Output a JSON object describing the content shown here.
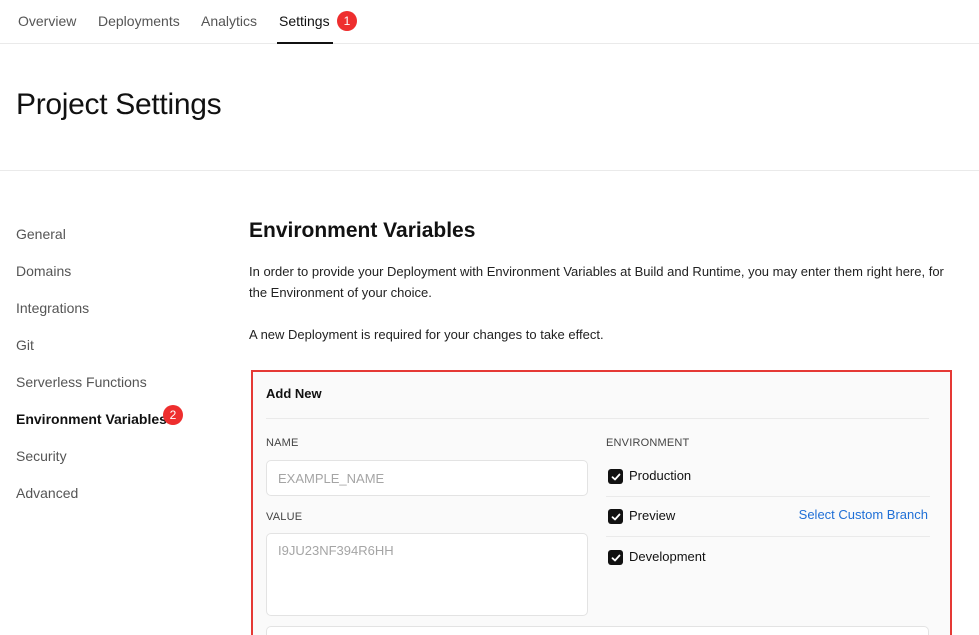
{
  "nav": {
    "tabs": [
      {
        "label": "Overview"
      },
      {
        "label": "Deployments"
      },
      {
        "label": "Analytics"
      },
      {
        "label": "Settings",
        "badge": "1"
      }
    ]
  },
  "header": {
    "title": "Project Settings"
  },
  "sidebar": {
    "items": [
      {
        "label": "General"
      },
      {
        "label": "Domains"
      },
      {
        "label": "Integrations"
      },
      {
        "label": "Git"
      },
      {
        "label": "Serverless Functions"
      },
      {
        "label": "Environment Variables",
        "badge": "2"
      },
      {
        "label": "Security"
      },
      {
        "label": "Advanced"
      }
    ]
  },
  "main": {
    "title": "Environment Variables",
    "description": "In order to provide your Deployment with Environment Variables at Build and Runtime, you may enter them right here, for the Environment of your choice.",
    "note": "A new Deployment is required for your changes to take effect."
  },
  "panel": {
    "title": "Add New",
    "name_label": "NAME",
    "name_placeholder": "EXAMPLE_NAME",
    "value_label": "VALUE",
    "value_placeholder": "I9JU23NF394R6HH",
    "environment_label": "ENVIRONMENT",
    "environments": [
      {
        "label": "Production",
        "checked": true
      },
      {
        "label": "Preview",
        "checked": true
      },
      {
        "label": "Development",
        "checked": true
      }
    ],
    "custom_branch_link": "Select Custom Branch"
  },
  "colors": {
    "badge": "#ee2e2e",
    "link": "#1f6fd6",
    "highlight_border": "#e53935"
  },
  "icons": {
    "checkbox": "checkmark-icon"
  }
}
